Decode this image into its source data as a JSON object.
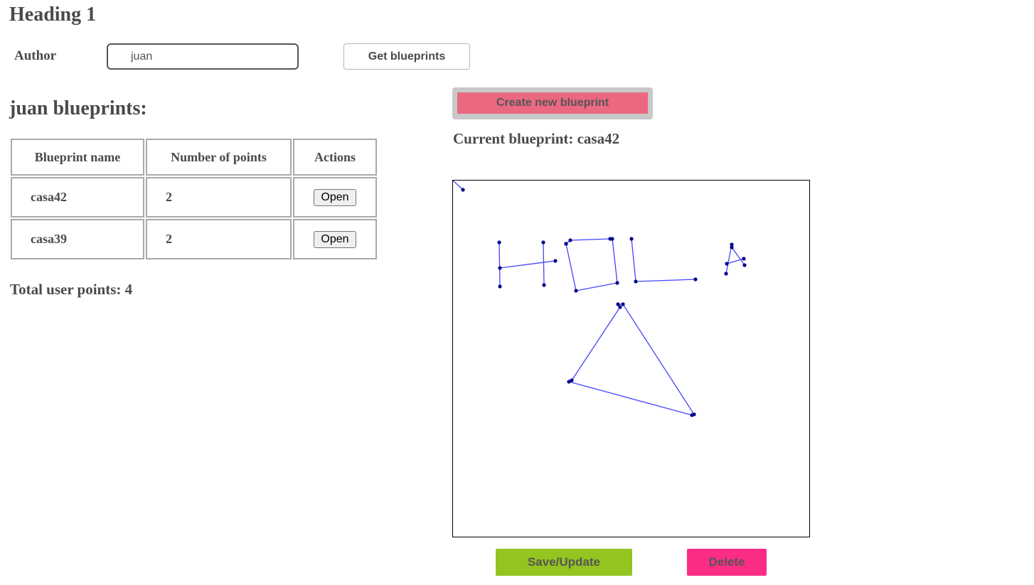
{
  "page": {
    "heading": "Heading 1"
  },
  "author": {
    "label": "Author",
    "value": "juan",
    "get_button_label": "Get blueprints"
  },
  "blueprints": {
    "title": "juan blueprints:",
    "columns": [
      "Blueprint name",
      "Number of points",
      "Actions"
    ],
    "rows": [
      {
        "name": "casa42",
        "points": "2",
        "action_label": "Open"
      },
      {
        "name": "casa39",
        "points": "2",
        "action_label": "Open"
      }
    ],
    "total_text": "Total user points: 4"
  },
  "editor": {
    "create_button_label": "Create new blueprint",
    "current_text": "Current blueprint: casa42",
    "save_button_label": "Save/Update",
    "delete_button_label": "Delete"
  },
  "colors": {
    "create_button": "#ea6880",
    "save_button": "#93c41f",
    "delete_button": "#fb2d85",
    "stroke": "#4343ff",
    "point": "#00008b"
  }
}
